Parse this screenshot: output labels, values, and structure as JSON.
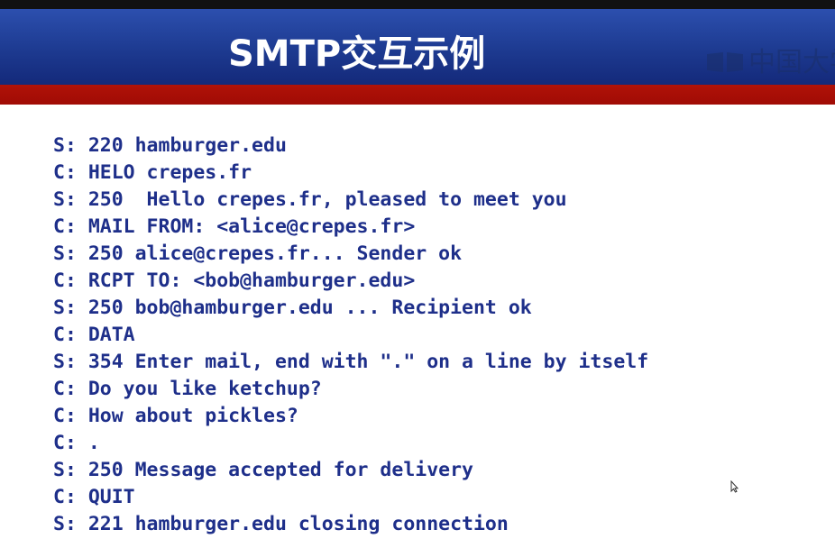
{
  "slide": {
    "title": "SMTP交互示例",
    "watermark_text": "中国大学"
  },
  "transcript": [
    "S: 220 hamburger.edu",
    "C: HELO crepes.fr",
    "S: 250  Hello crepes.fr, pleased to meet you",
    "C: MAIL FROM: <alice@crepes.fr>",
    "S: 250 alice@crepes.fr... Sender ok",
    "C: RCPT TO: <bob@hamburger.edu>",
    "S: 250 bob@hamburger.edu ... Recipient ok",
    "C: DATA",
    "S: 354 Enter mail, end with \".\" on a line by itself",
    "C: Do you like ketchup?",
    "C: How about pickles?",
    "C: .",
    "S: 250 Message accepted for delivery",
    "C: QUIT",
    "S: 221 hamburger.edu closing connection"
  ],
  "colors": {
    "title_band": "#1d3a90",
    "accent_band": "#a00b05",
    "text": "#1e2f8a"
  },
  "icons": {
    "watermark": "book-logo-icon",
    "pointer": "mouse-cursor-icon"
  }
}
